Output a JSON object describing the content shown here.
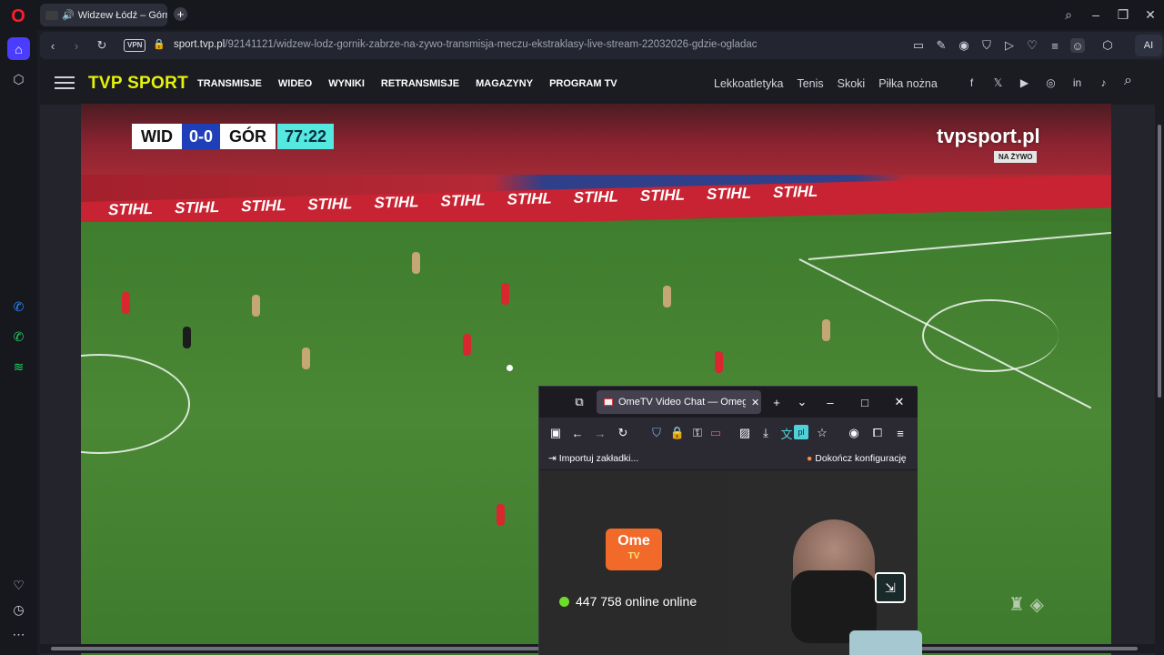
{
  "browser": {
    "tab_title": "Widzew Łódź – Górnik",
    "url_domain": "sport.tvp.pl",
    "url_path": "/92141121/widzew-lodz-gornik-zabrze-na-zywo-transmisja-meczu-ekstraklasy-live-stream-22032026-gdzie-ogladac",
    "vpn_label": "VPN",
    "ai_label": "AI"
  },
  "tvp": {
    "logo": "TVP SPORT",
    "main_nav": [
      "TRANSMISJE",
      "WIDEO",
      "WYNIKI",
      "RETRANSMISJE",
      "MAGAZYNY",
      "PROGRAM TV"
    ],
    "categories": [
      "Lekkoatletyka",
      "Tenis",
      "Skoki",
      "Piłka nożna"
    ],
    "social": [
      "f",
      "𝕏",
      "▶",
      "◎",
      "in",
      "♪"
    ]
  },
  "video": {
    "home_team": "WID",
    "score": "0-0",
    "away_team": "GÓR",
    "clock": "77:22",
    "watermark": "tvpsport.pl",
    "live_badge": "NA ŻYWO",
    "ad_text": "STIHL"
  },
  "firefox": {
    "tab_title": "OmeTV Video Chat — Omegle",
    "bookmark_import": "Importuj zakładki...",
    "bookmark_finish": "Dokończ konfigurację",
    "translate_badge": "pl"
  },
  "ometv": {
    "logo_top": "Ome",
    "logo_bottom": "TV",
    "online_text": "447 758 online online"
  },
  "colors": {
    "opera_red": "#ff1b2d",
    "tvp_yellow": "#e5f20a",
    "score_blue": "#1e3fb8",
    "clock_cyan": "#55e8e0",
    "ome_orange": "#f26a2a",
    "online_green": "#6ddc2b"
  }
}
